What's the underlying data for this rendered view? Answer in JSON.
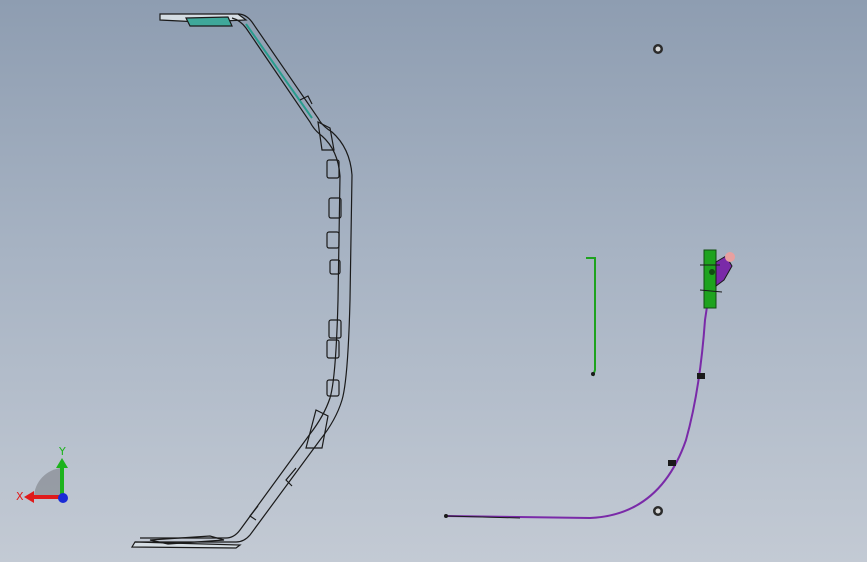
{
  "viewport": {
    "background_top": "#8e9db1",
    "background_bottom": "#c3cad4"
  },
  "triad": {
    "x_label": "X",
    "y_label": "Y",
    "x_color": "#e01a1a",
    "y_color": "#1db31d",
    "z_color": "#1a2bd6"
  },
  "colors": {
    "part_outline": "#1a1a1a",
    "part_highlight": "#2a9d8f",
    "rod": "#1ea31e",
    "cable": "#7a2aa8",
    "connector": "#e8a0a0"
  },
  "parts": {
    "bracket_frame": "sheet-metal-frame",
    "rod": "vertical-rod",
    "cable_assembly": "cable-with-connector",
    "fastener_top": "nut-fastener",
    "fastener_bottom": "nut-fastener"
  }
}
